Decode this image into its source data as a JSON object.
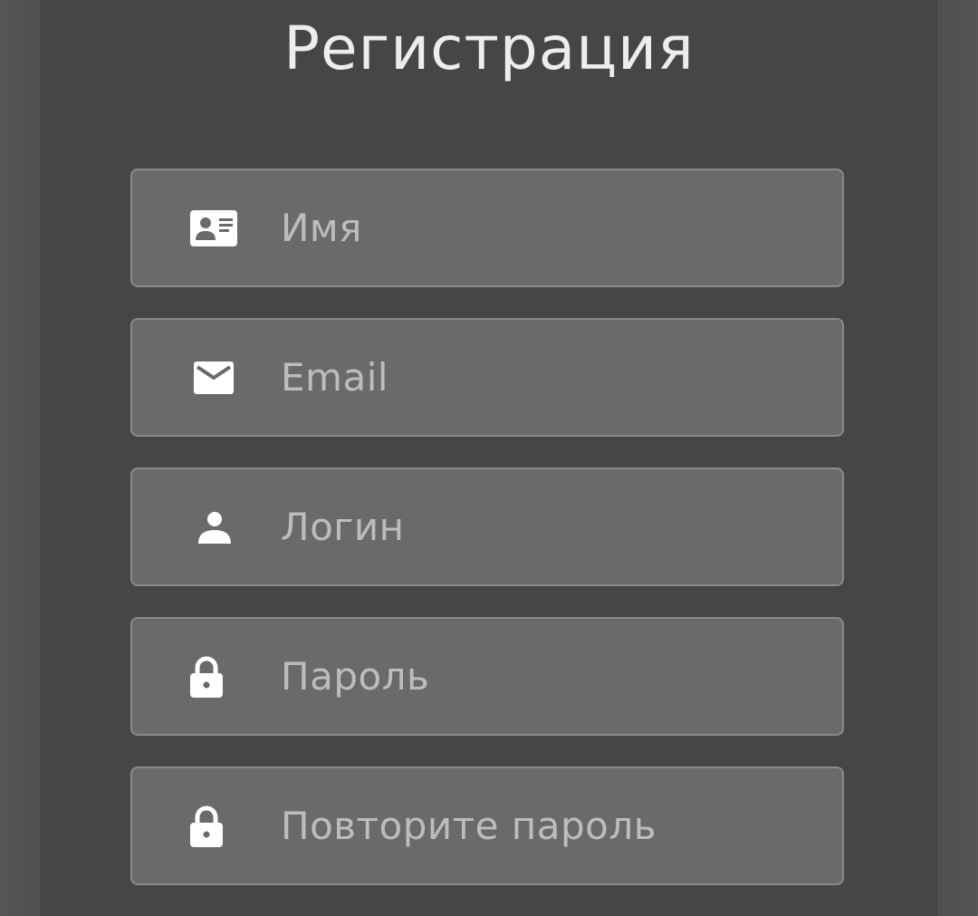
{
  "page": {
    "title": "Регистрация"
  },
  "form": {
    "fields": [
      {
        "name": "name",
        "placeholder": "Имя",
        "icon": "id-card-icon"
      },
      {
        "name": "email",
        "placeholder": "Email",
        "icon": "envelope-icon"
      },
      {
        "name": "login",
        "placeholder": "Логин",
        "icon": "user-icon"
      },
      {
        "name": "password",
        "placeholder": "Пароль",
        "icon": "lock-icon"
      },
      {
        "name": "password-repeat",
        "placeholder": "Повторите пароль",
        "icon": "lock-icon"
      }
    ]
  },
  "colors": {
    "background": "#464646",
    "field_background": "#6a6a6a",
    "field_border": "#8a8a8a",
    "title_text": "#ededed",
    "placeholder_text": "#bdbdbd",
    "icon": "#ffffff"
  }
}
